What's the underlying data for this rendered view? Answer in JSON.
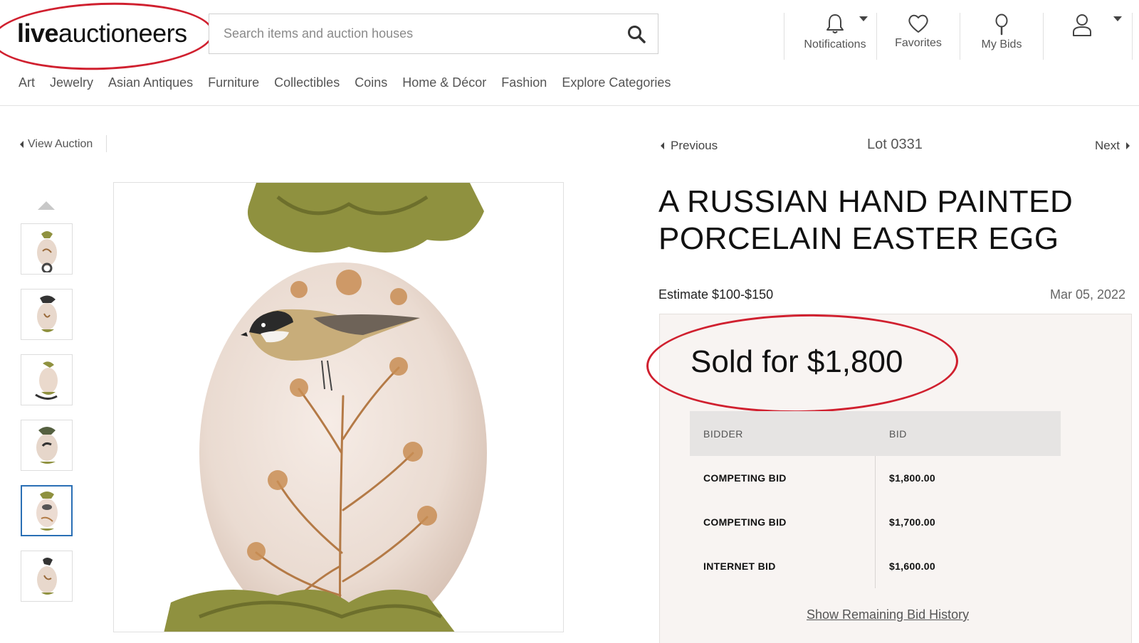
{
  "header": {
    "logo_bold": "live",
    "logo_rest": "auctioneers",
    "search_placeholder": "Search items and auction houses",
    "notifications_label": "Notifications",
    "favorites_label": "Favorites",
    "my_bids_label": "My Bids"
  },
  "nav": {
    "items": [
      "Art",
      "Jewelry",
      "Asian Antiques",
      "Furniture",
      "Collectibles",
      "Coins",
      "Home & Décor",
      "Fashion",
      "Explore Categories"
    ]
  },
  "subbar": {
    "view_auction": "View Auction",
    "previous": "Previous",
    "lot": "Lot 0331",
    "next": "Next"
  },
  "lot": {
    "title": "A RUSSIAN HAND PAINTED PORCELAIN EASTER EGG",
    "estimate": "Estimate $100-$150",
    "date": "Mar 05, 2022",
    "sold": "Sold for $1,800"
  },
  "bids": {
    "header_bidder": "BIDDER",
    "header_bid": "BID",
    "rows": [
      {
        "bidder": "COMPETING BID",
        "bid": "$1,800.00"
      },
      {
        "bidder": "COMPETING BID",
        "bid": "$1,700.00"
      },
      {
        "bidder": "INTERNET BID",
        "bid": "$1,600.00"
      }
    ],
    "show_more": "Show Remaining Bid History"
  },
  "colors": {
    "annotation_red": "#d0202f",
    "thumb_active": "#2a6fb5",
    "egg": "#efe2d9",
    "ribbon": "#8f913f",
    "panel_bg": "#f8f4f2"
  },
  "icons": [
    "bell-icon",
    "heart-icon",
    "paddle-icon",
    "user-icon",
    "search-icon"
  ]
}
